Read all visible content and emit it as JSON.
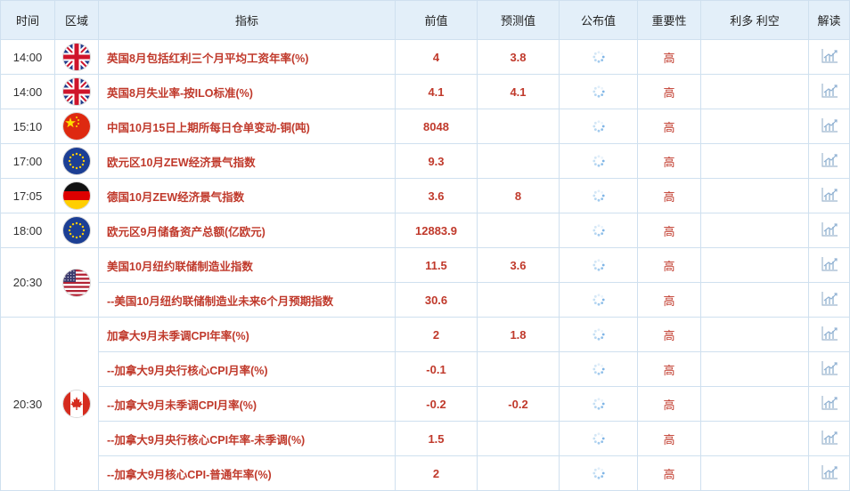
{
  "headers": {
    "time": "时间",
    "region": "区域",
    "indicator": "指标",
    "prev": "前值",
    "forecast": "预测值",
    "actual": "公布值",
    "importance": "重要性",
    "impact": "利多 利空",
    "interpret": "解读"
  },
  "groups": [
    {
      "time": "14:00",
      "flag": "uk",
      "items": [
        {
          "name": "英国8月包括红利三个月平均工资年率(%)",
          "prev": "4",
          "forecast": "3.8",
          "importance": "高"
        }
      ]
    },
    {
      "time": "14:00",
      "flag": "uk",
      "items": [
        {
          "name": "英国8月失业率-按ILO标准(%)",
          "prev": "4.1",
          "forecast": "4.1",
          "importance": "高"
        }
      ]
    },
    {
      "time": "15:10",
      "flag": "cn",
      "items": [
        {
          "name": "中国10月15日上期所每日仓单变动-铜(吨)",
          "prev": "8048",
          "forecast": "",
          "importance": "高"
        }
      ]
    },
    {
      "time": "17:00",
      "flag": "eu",
      "items": [
        {
          "name": "欧元区10月ZEW经济景气指数",
          "prev": "9.3",
          "forecast": "",
          "importance": "高"
        }
      ]
    },
    {
      "time": "17:05",
      "flag": "de",
      "items": [
        {
          "name": "德国10月ZEW经济景气指数",
          "prev": "3.6",
          "forecast": "8",
          "importance": "高"
        }
      ]
    },
    {
      "time": "18:00",
      "flag": "eu",
      "items": [
        {
          "name": "欧元区9月储备资产总额(亿欧元)",
          "prev": "12883.9",
          "forecast": "",
          "importance": "高"
        }
      ]
    },
    {
      "time": "20:30",
      "flag": "us",
      "items": [
        {
          "name": "美国10月纽约联储制造业指数",
          "prev": "11.5",
          "forecast": "3.6",
          "importance": "高"
        },
        {
          "name": "--美国10月纽约联储制造业未来6个月预期指数",
          "prev": "30.6",
          "forecast": "",
          "importance": "高"
        }
      ]
    },
    {
      "time": "20:30",
      "flag": "ca",
      "items": [
        {
          "name": "加拿大9月未季调CPI年率(%)",
          "prev": "2",
          "forecast": "1.8",
          "importance": "高"
        },
        {
          "name": "--加拿大9月央行核心CPI月率(%)",
          "prev": "-0.1",
          "forecast": "",
          "importance": "高"
        },
        {
          "name": "--加拿大9月未季调CPI月率(%)",
          "prev": "-0.2",
          "forecast": "-0.2",
          "importance": "高"
        },
        {
          "name": "--加拿大9月央行核心CPI年率-未季调(%)",
          "prev": "1.5",
          "forecast": "",
          "importance": "高"
        },
        {
          "name": "--加拿大9月核心CPI-普通年率(%)",
          "prev": "2",
          "forecast": "",
          "importance": "高"
        }
      ]
    }
  ],
  "icons": {
    "pending": "loading-spinner-icon",
    "interpret": "chart-analysis-icon"
  }
}
